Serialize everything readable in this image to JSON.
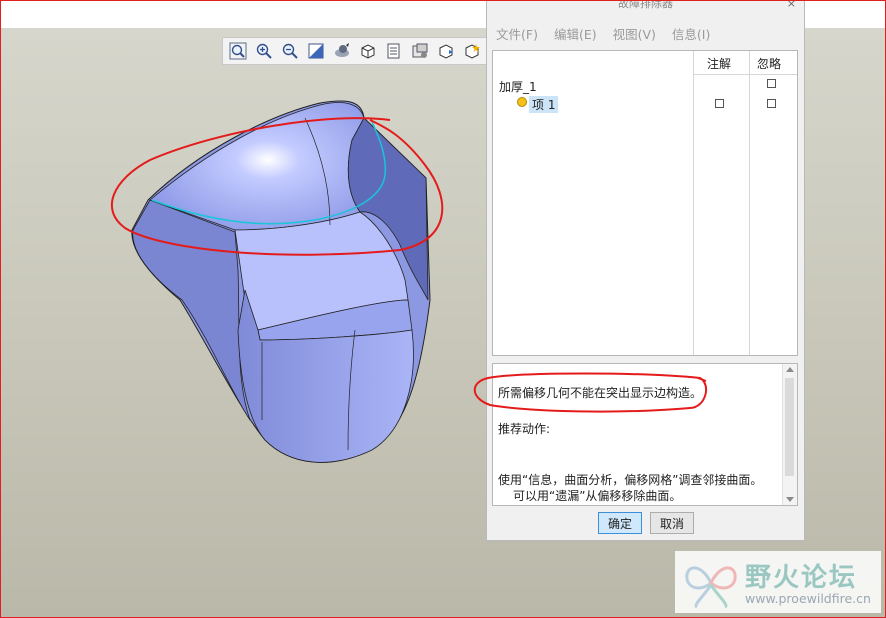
{
  "dialog": {
    "title": "故障排除器",
    "close": "×",
    "menu": [
      "文件(F)",
      "编辑(E)",
      "视图(V)",
      "信息(I)"
    ],
    "tree": {
      "headers": {
        "note": "注解",
        "ignore": "忽略"
      },
      "root": "加厚_1",
      "child": "项 1"
    },
    "message": {
      "main": "所需偏移几何不能在突出显示边构造。",
      "action_label": "推荐动作:",
      "line1": "使用“信息，曲面分析，偏移网格”调查邻接曲面。",
      "line2": "可以用“遗漏”从偏移移除曲面。"
    },
    "buttons": {
      "ok": "确定",
      "cancel": "取消"
    }
  },
  "toolbar": {
    "icons": [
      "zoom-fit-icon",
      "zoom-in-icon",
      "zoom-out-icon",
      "repaint-icon",
      "spin-center-icon",
      "display-style-icon",
      "saved-views-icon",
      "view-manager-icon",
      "annotation-display-icon",
      "datum-display-icon"
    ]
  },
  "watermark": {
    "cn": "野火论坛",
    "en": "www.proewildfire.cn"
  },
  "colors": {
    "model": "#a7b3f4",
    "annotation": "#e41b1b",
    "highlight": "#19c5d9"
  }
}
